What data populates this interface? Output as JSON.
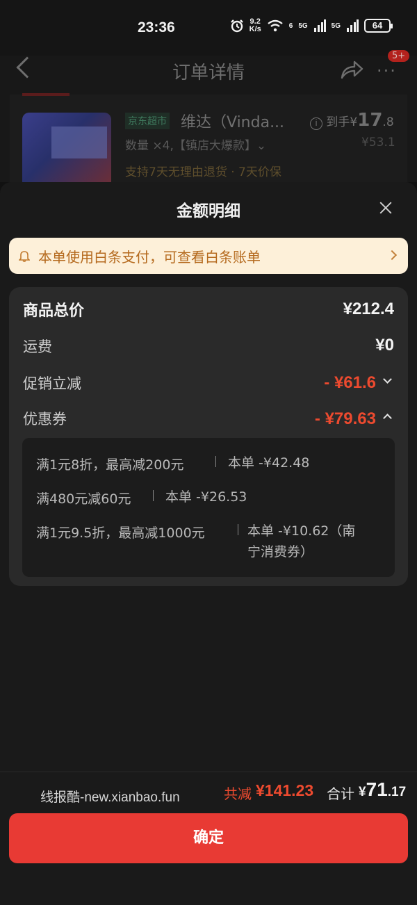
{
  "status_bar": {
    "time": "23:36",
    "net_speed_top": "9.2",
    "net_speed_bottom": "K/s",
    "net1": "6",
    "net2": "5G",
    "net3": "5G",
    "battery": "64"
  },
  "nav": {
    "title": "订单详情",
    "badge": "5+"
  },
  "product": {
    "store_tag": "京东超市",
    "name": "维达（Vinda...",
    "qty": "数量 ×4,【镇店大爆款】⌄",
    "daoshou_label": "到手",
    "daoshou_cur": "¥",
    "daoshou_int": "17",
    "daoshou_dec": ".8",
    "orig_price": "¥53.1",
    "support": "支持7天无理由退货 · 7天价保"
  },
  "sheet": {
    "title": "金额明细",
    "notice": "本单使用白条支付，可查看白条账单",
    "rows": [
      {
        "label": "商品总价",
        "value": "¥212.4"
      },
      {
        "label": "运费",
        "value": "¥0"
      },
      {
        "label": "促销立减",
        "value": "- ¥61.6"
      },
      {
        "label": "优惠券",
        "value": "- ¥79.63"
      }
    ],
    "coupons": [
      {
        "rule": "满1元8折，最高减200元",
        "amount": "本单 -¥42.48"
      },
      {
        "rule": "满480元减60元",
        "amount": "本单 -¥26.53"
      },
      {
        "rule": "满1元9.5折，最高减1000元",
        "amount_line1": "本单 -¥10.62（南",
        "amount_line2": "宁消费券）"
      }
    ]
  },
  "footer": {
    "watermark": "线报酷-new.xianbao.fun",
    "gongjian_label": "共减",
    "gongjian_value": "¥141.23",
    "heji_label": "合计",
    "heji_cur": "¥",
    "heji_int": "71",
    "heji_dec": ".17",
    "confirm": "确定"
  }
}
